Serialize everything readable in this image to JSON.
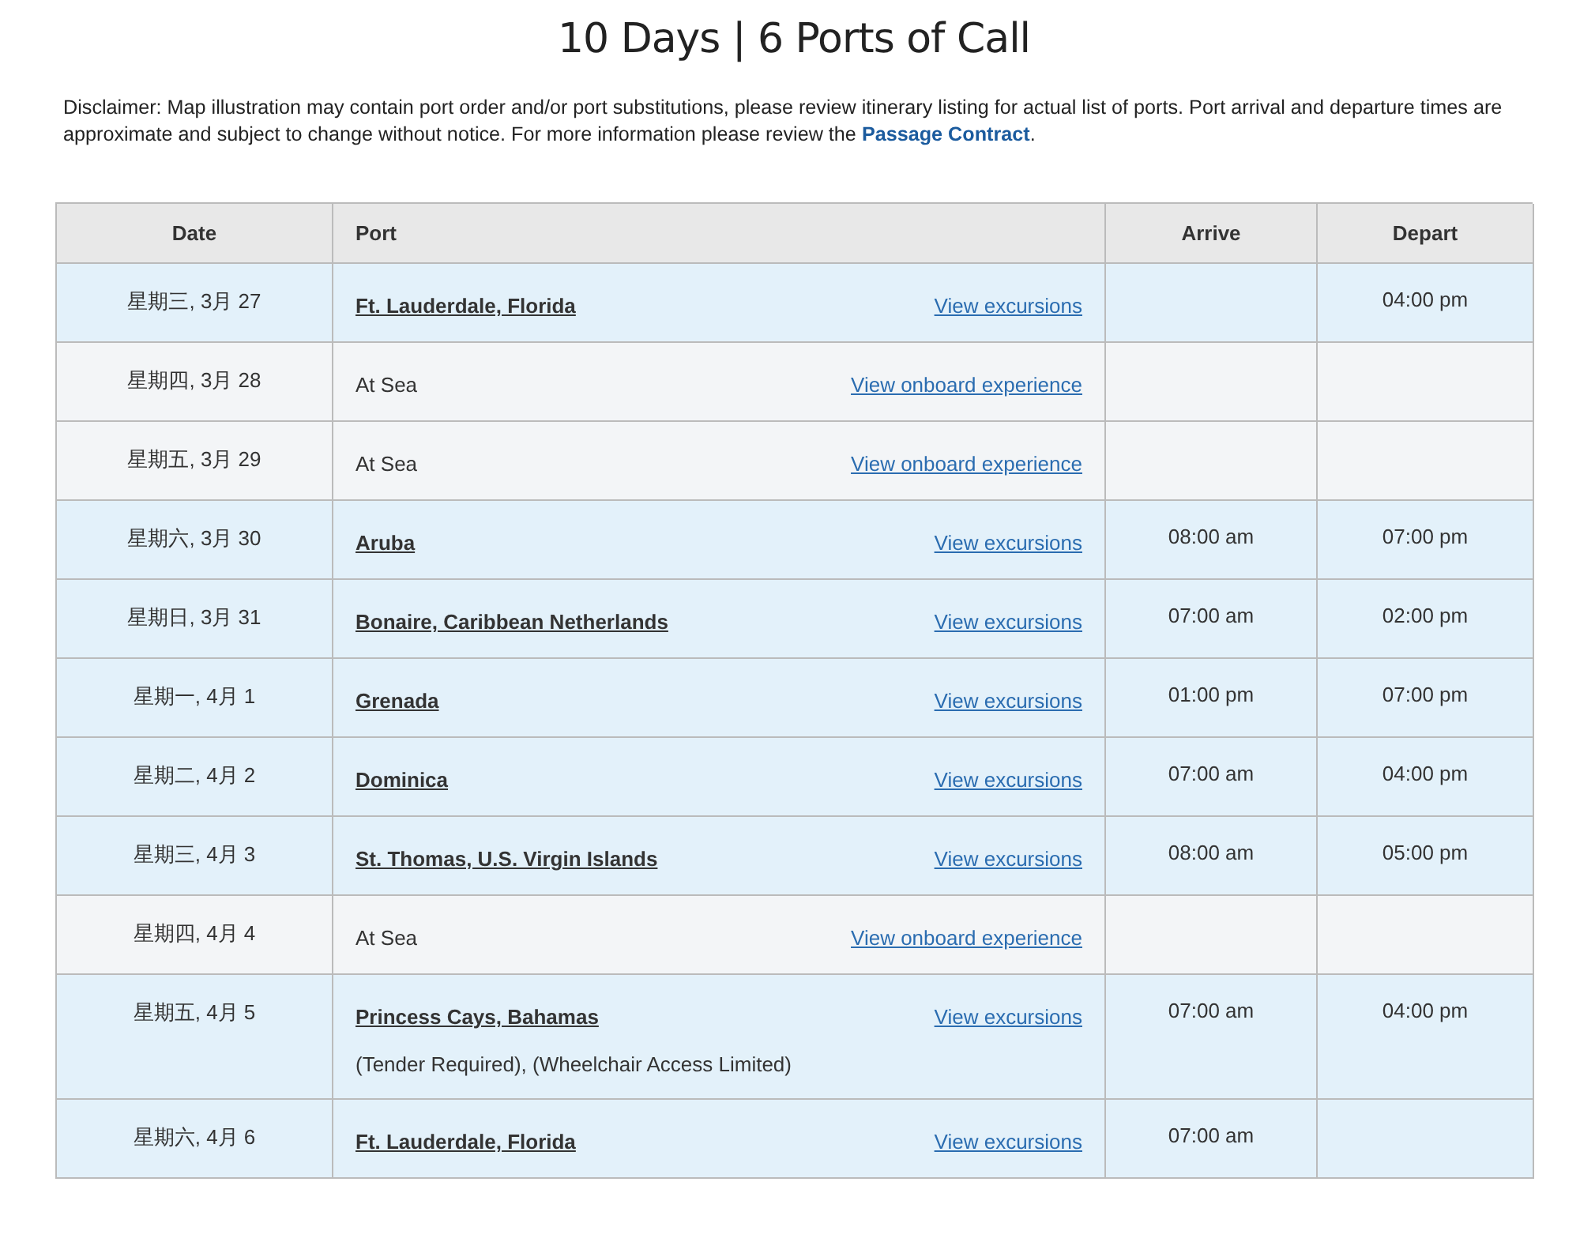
{
  "title": "10 Days | 6 Ports of Call",
  "disclaimer": {
    "text": "Disclaimer: Map illustration may contain port order and/or port substitutions, please review itinerary listing for actual list of ports. Port arrival and departure times are approximate and subject to change without notice. For more information please review the ",
    "link": "Passage Contract",
    "end": "."
  },
  "table": {
    "columns": [
      "Date",
      "Port",
      "Arrive",
      "Depart"
    ],
    "rows": [
      {
        "kind": "port",
        "date": "星期三, 3月 27",
        "port": "Ft. Lauderdale, Florida",
        "link": "View excursions",
        "depart": "04:00 pm"
      },
      {
        "kind": "sea",
        "date": "星期四, 3月 28",
        "port": "At Sea",
        "link": "View onboard experience"
      },
      {
        "kind": "sea",
        "date": "星期五, 3月 29",
        "port": "At Sea",
        "link": "View onboard experience"
      },
      {
        "kind": "port",
        "date": "星期六, 3月 30",
        "port": "Aruba",
        "link": "View excursions",
        "arrive": "08:00 am",
        "depart": "07:00 pm"
      },
      {
        "kind": "port",
        "date": "星期日, 3月 31",
        "port": "Bonaire, Caribbean Netherlands",
        "link": "View excursions",
        "arrive": "07:00 am",
        "depart": "02:00 pm"
      },
      {
        "kind": "port",
        "date": "星期一, 4月 1",
        "port": "Grenada",
        "link": "View excursions",
        "arrive": "01:00 pm",
        "depart": "07:00 pm"
      },
      {
        "kind": "port",
        "date": "星期二, 4月 2",
        "port": "Dominica",
        "link": "View excursions",
        "arrive": "07:00 am",
        "depart": "04:00 pm"
      },
      {
        "kind": "port",
        "date": "星期三, 4月 3",
        "port": "St. Thomas, U.S. Virgin Islands",
        "link": "View excursions",
        "arrive": "08:00 am",
        "depart": "05:00 pm"
      },
      {
        "kind": "sea",
        "date": "星期四, 4月 4",
        "port": "At Sea",
        "link": "View onboard experience"
      },
      {
        "kind": "port",
        "date": "星期五, 4月 5",
        "port": "Princess Cays, Bahamas",
        "link": "View excursions",
        "note": "(Tender Required), (Wheelchair Access Limited)",
        "arrive": "07:00 am",
        "depart": "04:00 pm"
      },
      {
        "kind": "port",
        "date": "星期六, 4月 6",
        "port": "Ft. Lauderdale, Florida",
        "link": "View excursions",
        "arrive": "07:00 am"
      }
    ]
  }
}
